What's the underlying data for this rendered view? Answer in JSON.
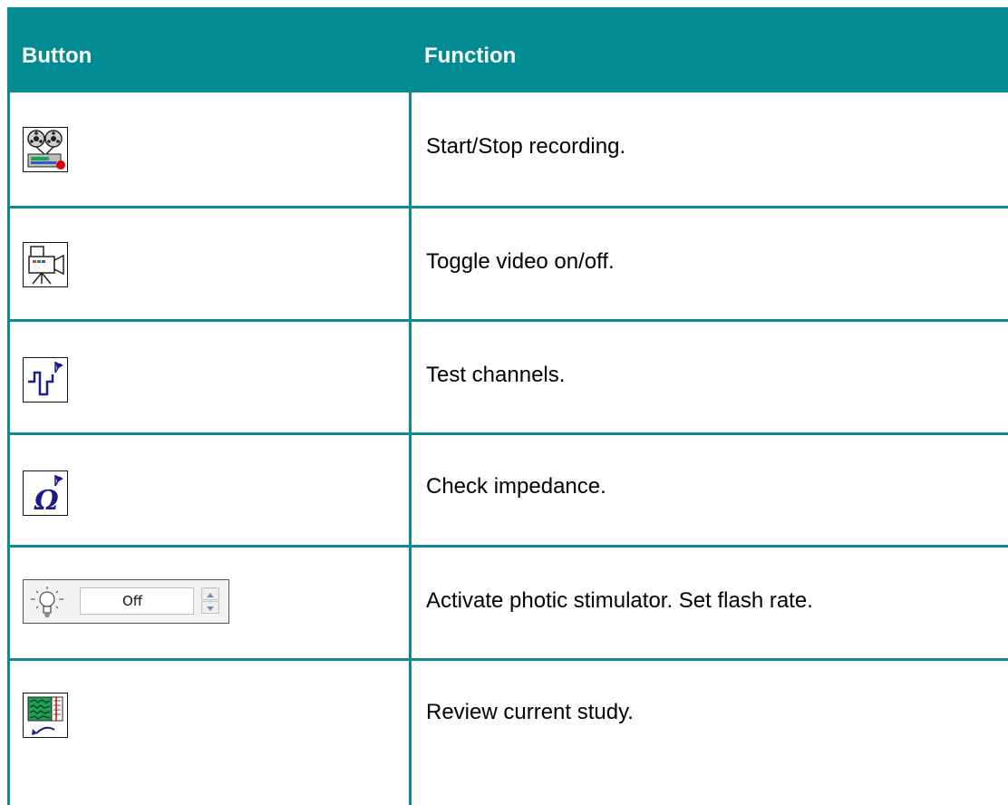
{
  "table": {
    "headers": {
      "button": "Button",
      "function": "Function"
    },
    "rows": [
      {
        "icon": "tape-recorder-record-icon",
        "function": "Start/Stop recording."
      },
      {
        "icon": "video-camera-icon",
        "function": "Toggle video on/off."
      },
      {
        "icon": "square-wave-test-icon",
        "function": "Test channels."
      },
      {
        "icon": "omega-impedance-icon",
        "function": "Check impedance."
      },
      {
        "icon": "light-bulb-icon",
        "function": "Activate photic stimulator. Set flash rate.",
        "control_value": "Off"
      },
      {
        "icon": "review-study-icon",
        "function": "Review current study."
      }
    ]
  },
  "colors": {
    "header_bg": "#028b93",
    "grid": "#0f8a91",
    "header_text": "#ffffff"
  }
}
